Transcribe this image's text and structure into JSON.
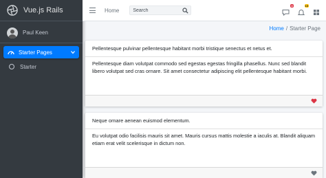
{
  "brand": {
    "name": "Vue.js Rails"
  },
  "user": {
    "name": "Paul Keen"
  },
  "sidebar": {
    "items": [
      {
        "label": "Starter Pages",
        "icon": "dashboard-icon",
        "active": true
      },
      {
        "label": "Starter",
        "icon": "circle-icon",
        "active": false
      }
    ]
  },
  "header": {
    "home_label": "Home",
    "search": {
      "placeholder": "Search"
    },
    "notifications": [
      {
        "icon": "comments-icon",
        "badge": "3",
        "color": "#dc3545"
      },
      {
        "icon": "bell-icon",
        "badge": "15",
        "color": "#ffc107"
      },
      {
        "icon": "apps-grid-icon"
      }
    ]
  },
  "breadcrumb": {
    "link": "Home",
    "separator": "/",
    "current": "Starter Page"
  },
  "cards": [
    {
      "header": "Pellentesque pulvinar pellentesque habitant morbi tristique senectus et netus et.",
      "body": "Pellentesque diam volutpat commodo sed egestas egestas fringilla phasellus. Nunc sed blandit libero volutpat sed cras ornare. Sit amet consectetur adipiscing elit pellentesque habitant morbi.",
      "footer_icon": "heart-icon",
      "heart_color": "#dc3545"
    },
    {
      "header": "Neque ornare aenean euismod elementum.",
      "body": "Eu volutpat odio facilisis mauris sit amet. Mauris cursus mattis molestie a iaculis at. Blandit aliquam etiam erat velit scelerisque in dictum non.",
      "footer_icon": "heart-icon",
      "heart_color": "#6c757d"
    }
  ],
  "colors": {
    "sidebar": "#343a40",
    "accent": "#007bff",
    "background": "#f4f6f9"
  }
}
